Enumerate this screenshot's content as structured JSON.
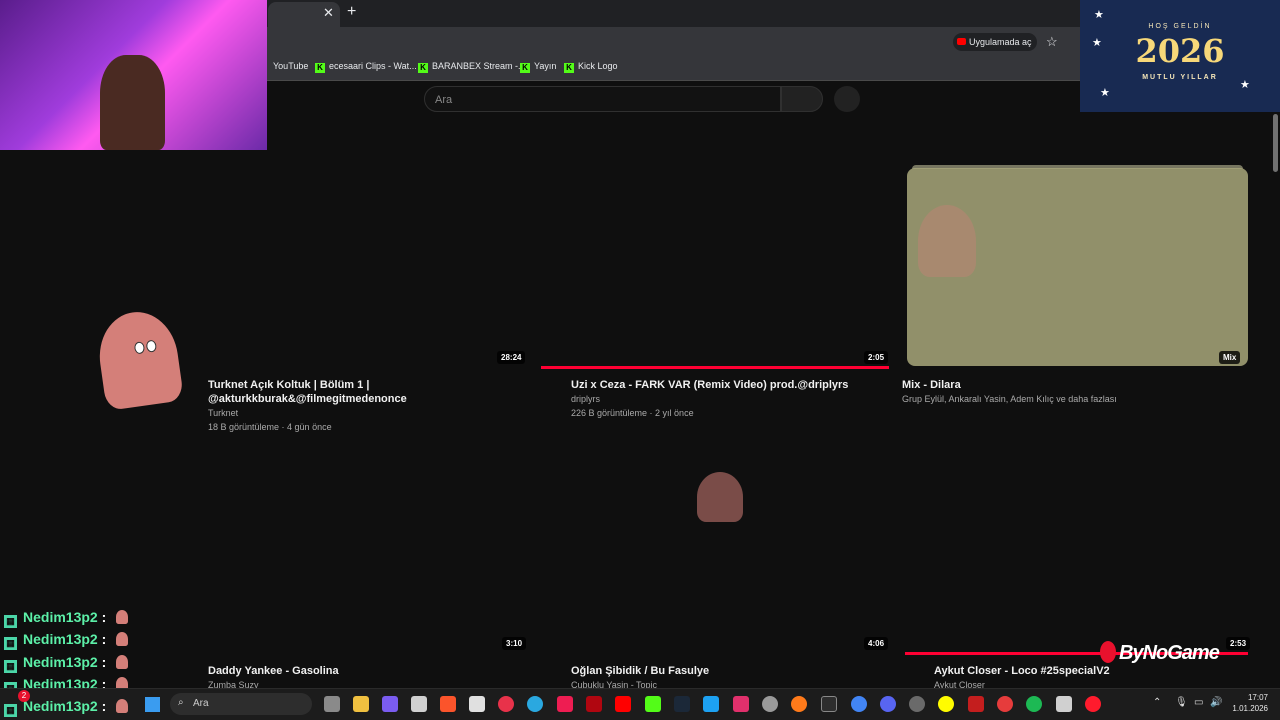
{
  "browser": {
    "open_in_app_label": "Uygulamada aç",
    "bookmarks": [
      {
        "label": "YouTube"
      },
      {
        "label": "ecesaari Clips - Wat..."
      },
      {
        "label": "BARANBEX Stream -..."
      },
      {
        "label": "Yayın"
      },
      {
        "label": "Kick Logo"
      }
    ]
  },
  "search": {
    "placeholder": "Ara"
  },
  "banner": {
    "line1": "HOŞ GELDİN",
    "year": "2026",
    "line2": "MUTLU YILLAR"
  },
  "videos": [
    {
      "title_line1": "Turknet Açık Koltuk | Bölüm 1 |",
      "title_line2": "@akturkkburak&@filmegitmedenonce",
      "channel": "Turknet",
      "meta": "18 B görüntüleme · 4 gün önce",
      "duration": "28:24"
    },
    {
      "title_line1": "Uzi x Ceza - FARK VAR (Remix Video) prod.@driplyrs",
      "channel": "driplyrs",
      "meta": "226 B görüntüleme · 2 yıl önce",
      "duration": "2:05"
    },
    {
      "title_line1": "Mix - Dilara",
      "channel": "Grup Eylül, Ankaralı Yasin, Adem Kılıç ve daha fazlası",
      "duration": "Mix"
    },
    {
      "title_line1": "Daddy Yankee - Gasolina",
      "channel": "Zumba Suzy",
      "duration": "3:10"
    },
    {
      "title_line1": "Oğlan Şibidik / Bu Fasulye",
      "channel": "Çubuklu Yasin - Topic",
      "duration": "4:06"
    },
    {
      "title_line1": "Aykut Closer - Loco #25specialV2",
      "channel": "Aykut Closer",
      "duration": "2:53"
    }
  ],
  "chat": {
    "username": "Nedim13p2",
    "separator": ":"
  },
  "overlay": {
    "brand": "ByNoGame"
  },
  "taskbar": {
    "search_label": "Ara",
    "badge_count": "2",
    "time": "17:07",
    "date": "1.01.2026"
  },
  "colors": {
    "accent": "#ff0033",
    "chat_name": "#5cf0a8",
    "kick_green": "#53fc18",
    "mix_thumb": "#a8a77a"
  }
}
